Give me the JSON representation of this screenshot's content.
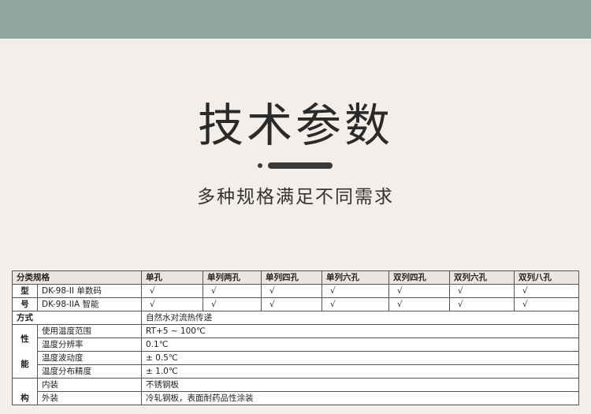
{
  "header": {
    "title": "技术参数",
    "subtitle": "多种规格满足不同需求"
  },
  "table": {
    "corner": "分类规格",
    "columns": [
      "单孔",
      "单列两孔",
      "单列四孔",
      "单列六孔",
      "双列四孔",
      "双列六孔",
      "双列八孔"
    ],
    "model_group": [
      "型",
      "号"
    ],
    "models": [
      {
        "name": "DK-98-II 单数码",
        "marks": [
          "√",
          "√",
          "√",
          "√",
          "√",
          "√",
          "√"
        ]
      },
      {
        "name": "DK-98-IIA 智能",
        "marks": [
          "√",
          "√",
          "√",
          "√",
          "√",
          "√",
          "√"
        ]
      }
    ],
    "mode": {
      "label": "方式",
      "value": "自然水对流热传递"
    },
    "perf_group": [
      "性",
      "能"
    ],
    "performance": [
      {
        "label": "使用温度范围",
        "value": "RT+5 ~ 100℃"
      },
      {
        "label": "温度分辨率",
        "value": "0.1℃"
      },
      {
        "label": "温度波动度",
        "value": "± 0.5℃"
      },
      {
        "label": "温度分布精度",
        "value": "± 1.0℃"
      }
    ],
    "struct_group": [
      "构"
    ],
    "structure": [
      {
        "label": "内装",
        "value": "不锈钢板"
      },
      {
        "label": "外装",
        "value": "冷轧钢板，表面耐药品性涂装"
      }
    ]
  }
}
